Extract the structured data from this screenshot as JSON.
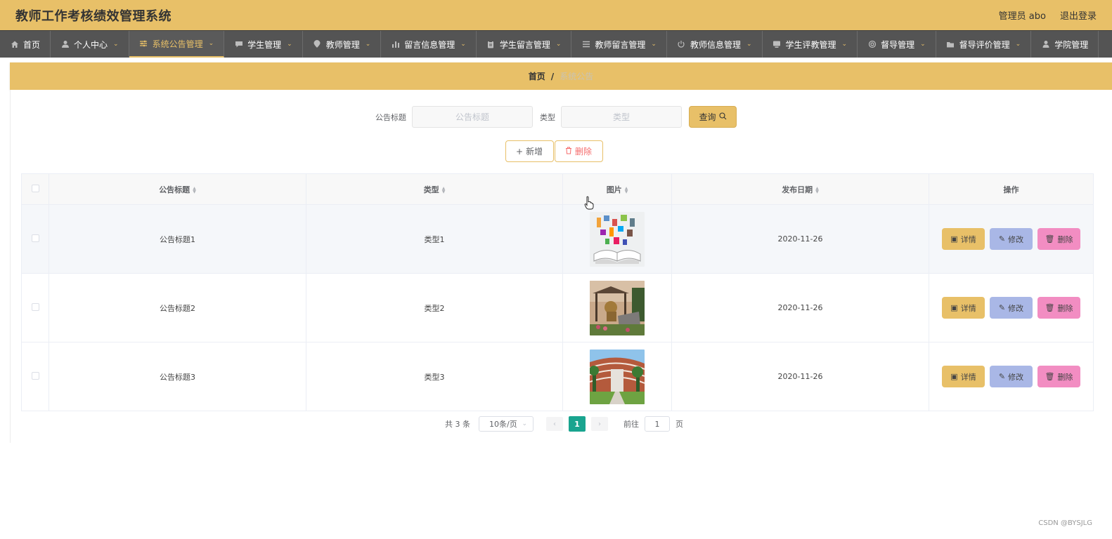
{
  "header": {
    "title": "教师工作考核绩效管理系统",
    "user_label": "管理员 abo",
    "logout_label": "退出登录"
  },
  "nav": {
    "items": [
      {
        "label": "首页",
        "icon": "home-icon"
      },
      {
        "label": "个人中心",
        "icon": "user-icon"
      },
      {
        "label": "系统公告管理",
        "icon": "sliders-icon"
      },
      {
        "label": "学生管理",
        "icon": "chat-icon"
      },
      {
        "label": "教师管理",
        "icon": "location-icon"
      },
      {
        "label": "留言信息管理",
        "icon": "bar-chart-icon"
      },
      {
        "label": "学生留言管理",
        "icon": "clipboard-icon"
      },
      {
        "label": "教师留言管理",
        "icon": "list-icon"
      },
      {
        "label": "教师信息管理",
        "icon": "power-icon"
      },
      {
        "label": "学生评教管理",
        "icon": "monitor-icon"
      },
      {
        "label": "督导管理",
        "icon": "gear-icon"
      },
      {
        "label": "督导评价管理",
        "icon": "folder-icon"
      },
      {
        "label": "学院管理",
        "icon": "person-icon"
      }
    ],
    "active_index": 2
  },
  "breadcrumb": {
    "home": "首页",
    "separator": "/",
    "current": "系统公告"
  },
  "search": {
    "title_label": "公告标题",
    "title_placeholder": "公告标题",
    "type_label": "类型",
    "type_placeholder": "类型",
    "query_label": "查询"
  },
  "actions": {
    "add_label": "新增",
    "delete_label": "删除"
  },
  "table": {
    "columns": [
      "公告标题",
      "类型",
      "图片",
      "发布日期",
      "操作"
    ],
    "rows": [
      {
        "title": "公告标题1",
        "type": "类型1",
        "image": "book-illustration",
        "date": "2020-11-26"
      },
      {
        "title": "公告标题2",
        "type": "类型2",
        "image": "campus-sculpture",
        "date": "2020-11-26"
      },
      {
        "title": "公告标题3",
        "type": "类型3",
        "image": "campus-building",
        "date": "2020-11-26"
      }
    ],
    "row_actions": {
      "detail": "详情",
      "edit": "修改",
      "delete": "删除"
    }
  },
  "pagination": {
    "total_text": "共 3 条",
    "page_size": "10条/页",
    "current_page": "1",
    "goto_label": "前往",
    "goto_value": "1",
    "page_suffix": "页"
  },
  "watermark": "CSDN @BYSJLG",
  "colors": {
    "accent": "#e8c068",
    "nav_bg": "#545454",
    "edit_btn": "#a9b7e6",
    "delete_btn": "#f28dc2",
    "page_active": "#19a48f"
  }
}
